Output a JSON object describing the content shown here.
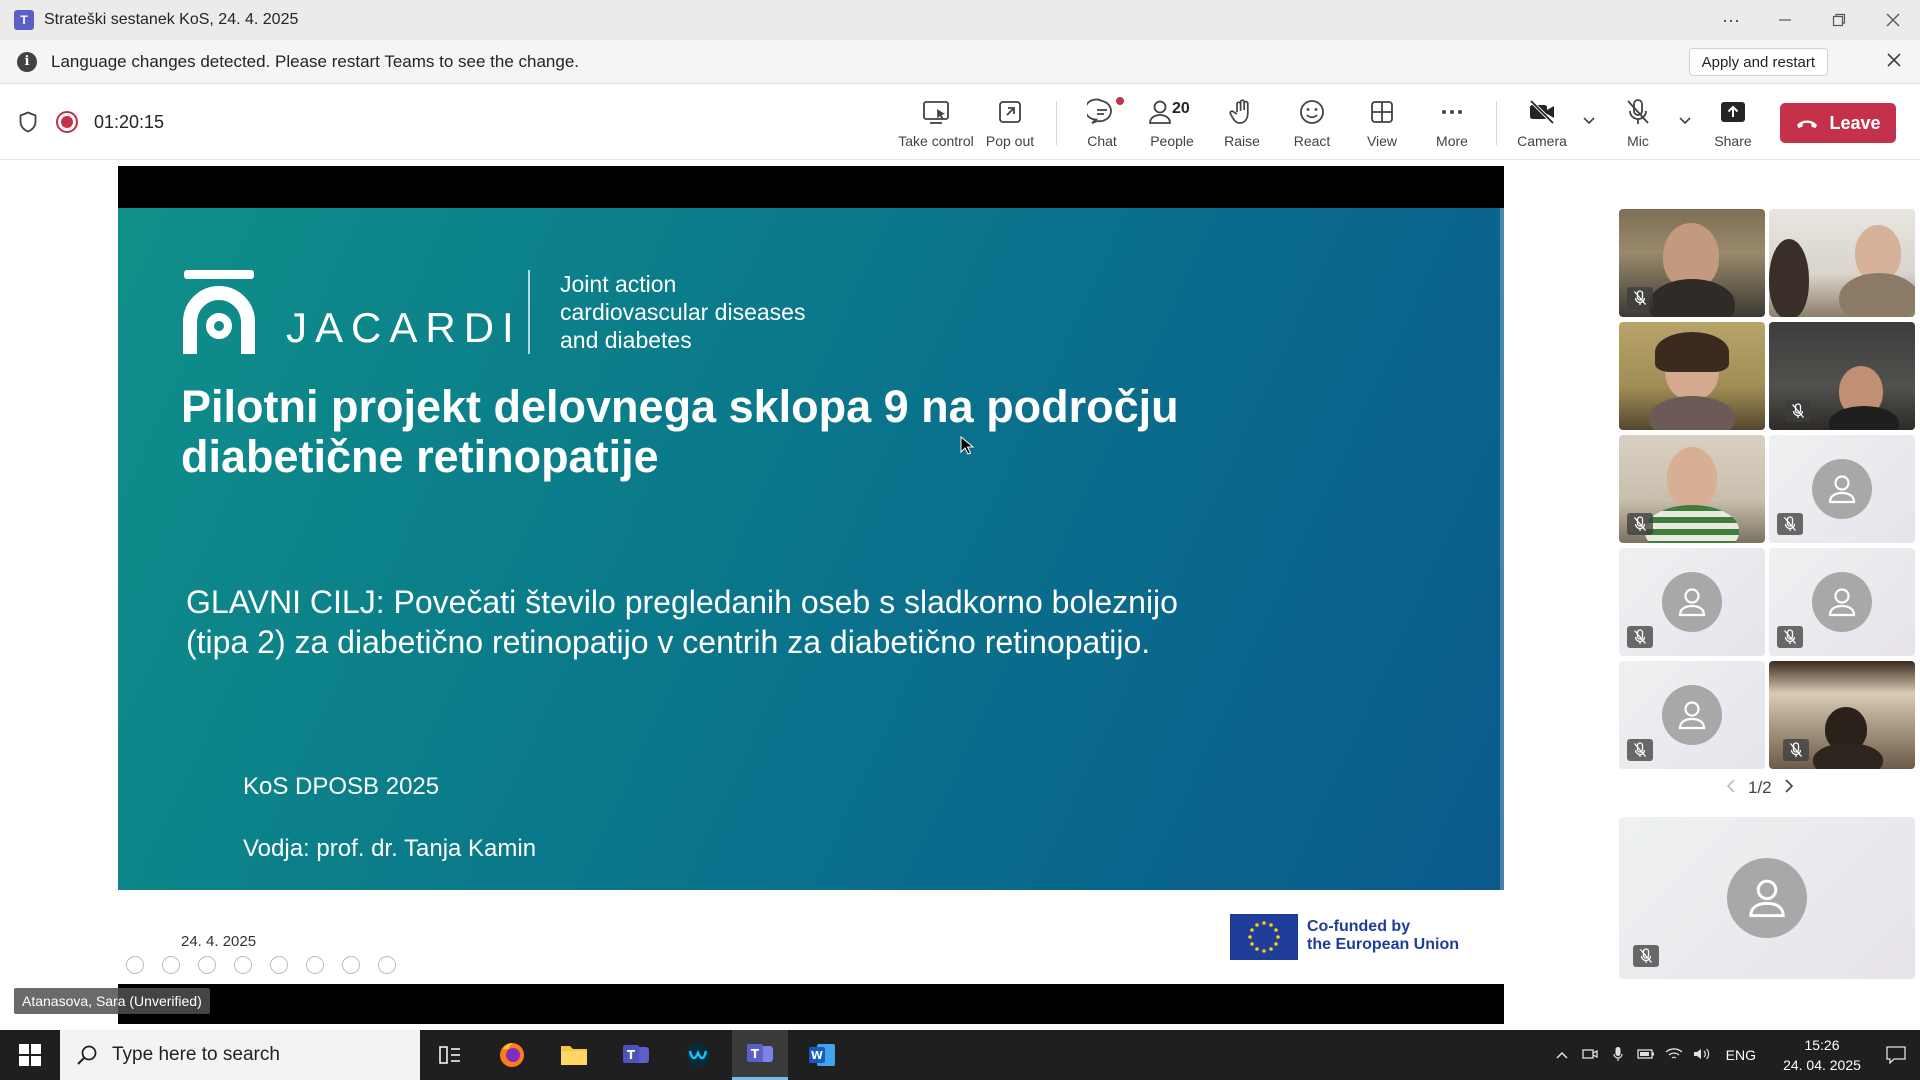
{
  "window": {
    "title": "Strateški sestanek KoS, 24. 4. 2025",
    "app_logo": "T",
    "controls": [
      "more-icon",
      "minimize-icon",
      "restore-icon",
      "close-icon"
    ]
  },
  "notification": {
    "message": "Language changes detected. Please restart Teams to see the change.",
    "apply_label": "Apply and restart"
  },
  "meeting": {
    "timer": "01:20:15",
    "toolbar": {
      "take_control": "Take control",
      "pop_out": "Pop out",
      "chat": "Chat",
      "people": "People",
      "people_count": "20",
      "raise": "Raise",
      "react": "React",
      "view": "View",
      "more": "More",
      "camera": "Camera",
      "mic": "Mic",
      "share": "Share",
      "leave": "Leave"
    },
    "colors": {
      "leave": "#c4314b",
      "recording": "#c4314b",
      "brand": "#5b5fc7"
    }
  },
  "slide": {
    "brand": "JACARDI",
    "tagline": [
      "Joint action",
      "cardiovascular diseases",
      "and diabetes"
    ],
    "title": [
      "Pilotni projekt delovnega sklopa 9 na področju",
      "diabetične retinopatije"
    ],
    "goal": [
      "GLAVNI CILJ:  Povečati število pregledanih oseb s sladkorno boleznijo",
      "(tipa 2) za diabetično retinopatijo v centrih za diabetično retinopatijo."
    ],
    "event": "KoS DPOSB 2025",
    "leader": "Vodja: prof. dr. Tanja Kamin",
    "footer_date": "24. 4. 2025",
    "eu_text": [
      "Co-funded by",
      "the European Union"
    ]
  },
  "presenter": "Atanasova, Sara (Unverified)",
  "gallery": {
    "page": "1/2"
  },
  "taskbar": {
    "search_placeholder": "Type here to search",
    "language": "ENG",
    "time": "15:26",
    "date": "24. 04. 2025"
  }
}
